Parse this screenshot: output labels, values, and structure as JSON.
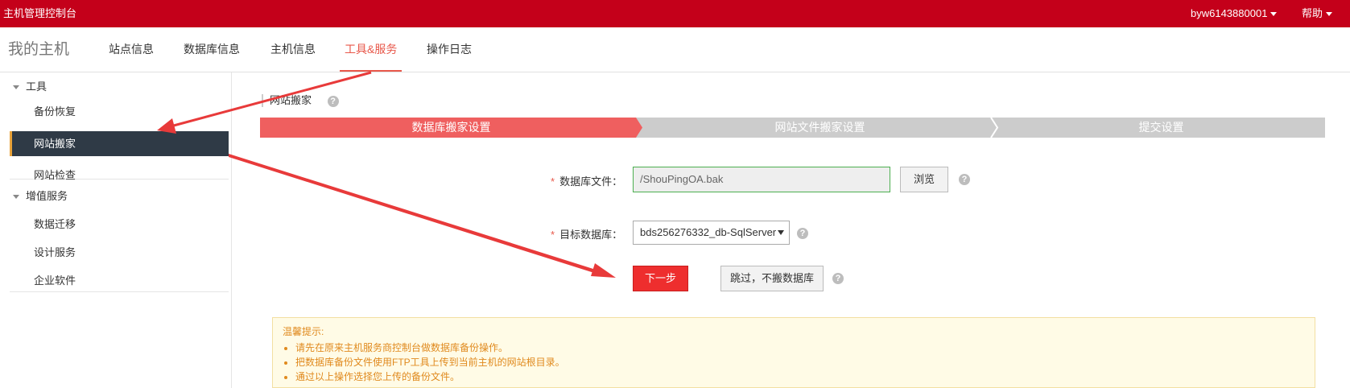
{
  "topbar": {
    "brand": "主机管理控制台",
    "user": "byw6143880001",
    "help": "帮助"
  },
  "nav": {
    "title": "我的主机",
    "tabs": [
      "站点信息",
      "数据库信息",
      "主机信息",
      "工具&服务",
      "操作日志"
    ],
    "active": "工具&服务"
  },
  "sidebar": {
    "group1": "工具",
    "items1": [
      "备份恢复",
      "网站搬家",
      "网站检查"
    ],
    "group2": "增值服务",
    "items2": [
      "数据迁移",
      "设计服务",
      "企业软件"
    ]
  },
  "main": {
    "section_title": "网站搬家",
    "steps": [
      "数据库搬家设置",
      "网站文件搬家设置",
      "提交设置"
    ],
    "db_file_label": "数据库文件：",
    "db_file_value": "/ShouPingOA.bak",
    "browse": "浏览",
    "target_db_label": "目标数据库：",
    "target_db_value": "bds256276332_db-SqlServer",
    "next": "下一步",
    "skip": "跳过，不搬数据库",
    "help_glyph": "?"
  },
  "notice": {
    "title": "温馨提示:",
    "tips": [
      "请先在原来主机服务商控制台做数据库备份操作。",
      "把数据库备份文件使用FTP工具上传到当前主机的网站根目录。",
      "通过以上操作选择您上传的备份文件。"
    ]
  },
  "colors": {
    "topbar": "#c4001a",
    "accent": "#e8584b",
    "step_active": "#ef5f5f",
    "step_inactive": "#cccccc",
    "sidebar_active": "#2f3a46",
    "primary_button": "#ee2e2e",
    "annotation_arrow": "#e83a3a"
  }
}
